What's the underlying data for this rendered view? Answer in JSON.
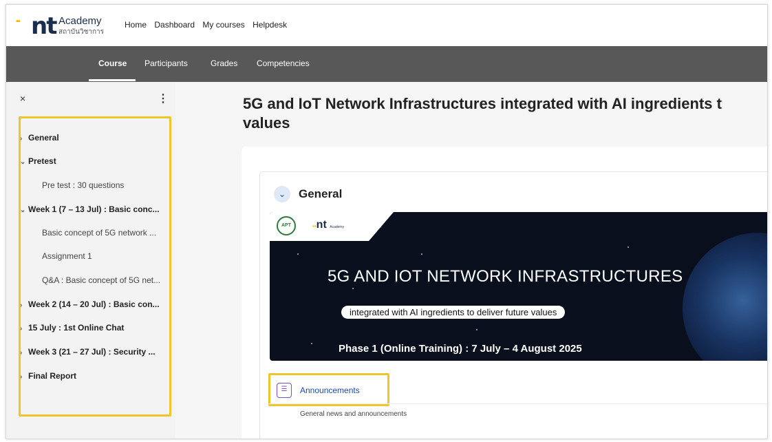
{
  "brand": {
    "nt": "nt",
    "academy": "Academy",
    "thai": "สถาบันวิชาการ"
  },
  "topnav": [
    "Home",
    "Dashboard",
    "My courses",
    "Helpdesk"
  ],
  "secnav": {
    "course": "Course",
    "participants": "Participants",
    "grades": "Grades",
    "competencies": "Competencies"
  },
  "drawer": {
    "close": "×",
    "more": "⋮",
    "items": [
      {
        "label": "General",
        "chevron": "›"
      },
      {
        "label": "Pretest",
        "chevron": "⌄"
      },
      {
        "label": "Pre test : 30 questions"
      },
      {
        "label": "Week 1 (7 – 13 Jul) : Basic conc...",
        "chevron": "⌄"
      },
      {
        "label": "Basic concept of 5G network ..."
      },
      {
        "label": "Assignment 1"
      },
      {
        "label": "Q&A : Basic concept of 5G net..."
      },
      {
        "label": "Week 2 (14 – 20 Jul) : Basic con...",
        "chevron": "›"
      },
      {
        "label": "15 July : 1st Online Chat",
        "chevron": "›"
      },
      {
        "label": "Week 3 (21 – 27 Jul) : Security ...",
        "chevron": "›"
      },
      {
        "label": "Final Report",
        "chevron": "›"
      }
    ]
  },
  "main": {
    "title_line1": "5G and IoT Network Infrastructures integrated with AI ingredients t",
    "title_line2": "values",
    "section_toggle": "⌄",
    "section_title": "General",
    "banner": {
      "apt": "APT",
      "nt": "nt",
      "nt_small": "Academy",
      "title": "5G AND IOT NETWORK INFRASTRUCTURES",
      "pill": "integrated with AI ingredients to deliver future values",
      "subtitle": "Phase 1 (Online Training) : 7 July – 4 August 2025"
    },
    "announcements": {
      "label": "Announcements",
      "description": "General news and announcements",
      "icon": "chat-icon"
    }
  }
}
